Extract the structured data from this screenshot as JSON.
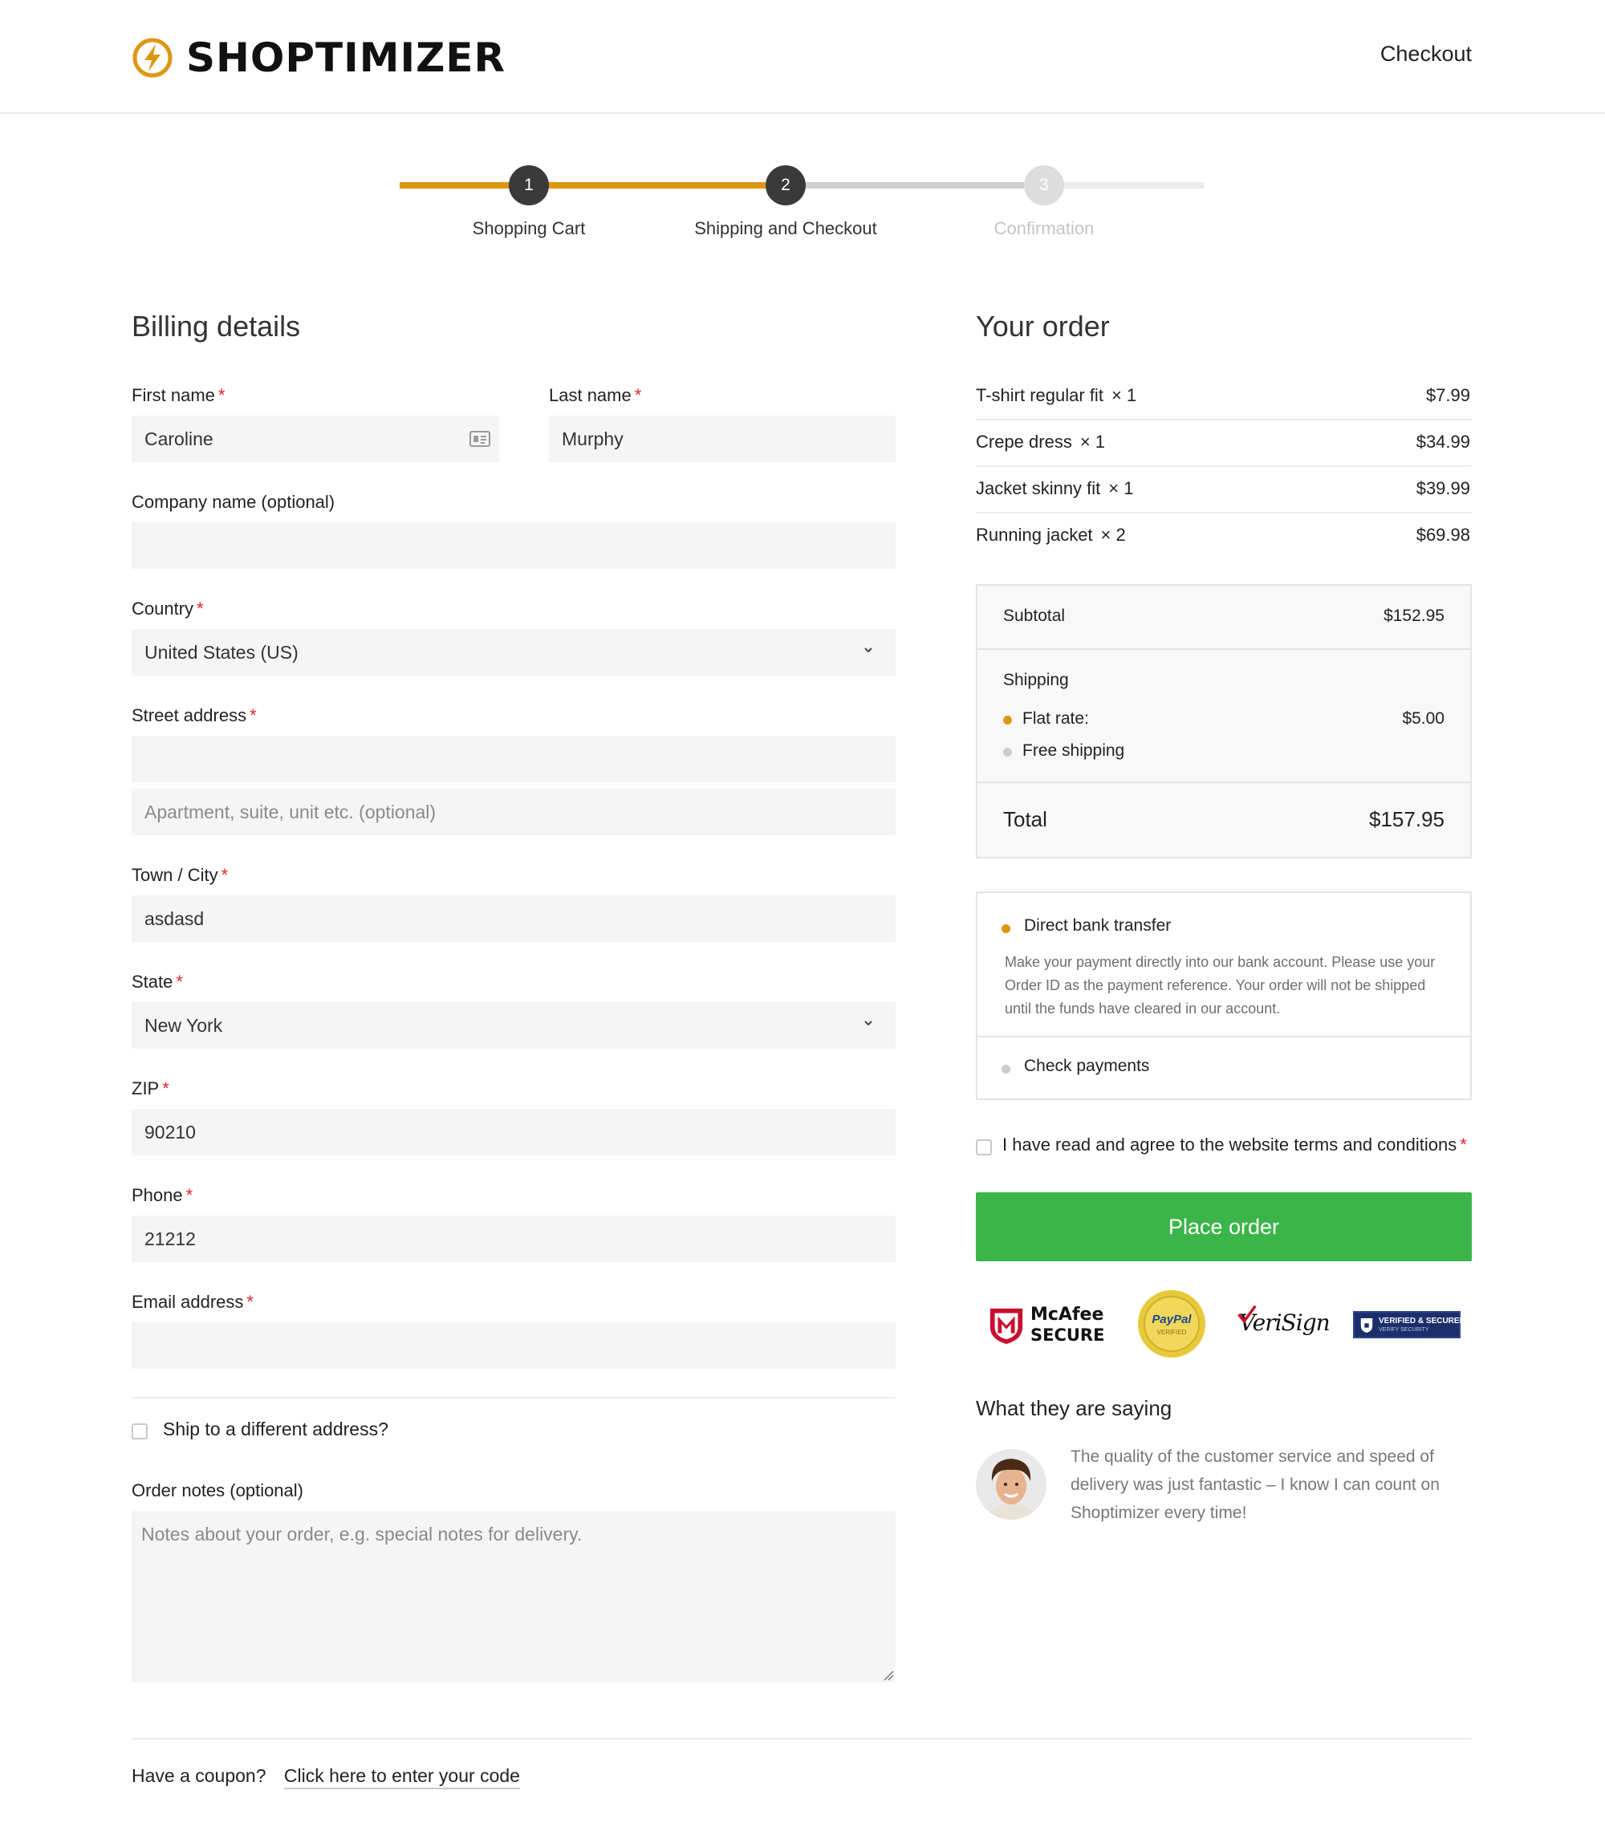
{
  "header": {
    "brand": "SHOPTIMIZER",
    "title": "Checkout"
  },
  "steps": [
    {
      "number": "1",
      "label": "Shopping Cart",
      "state": "done"
    },
    {
      "number": "2",
      "label": "Shipping and Checkout",
      "state": "active"
    },
    {
      "number": "3",
      "label": "Confirmation",
      "state": "upcoming"
    }
  ],
  "billing": {
    "title": "Billing details",
    "required_mark": "*",
    "first_name": {
      "label": "First name",
      "value": "Caroline"
    },
    "last_name": {
      "label": "Last name",
      "value": "Murphy"
    },
    "company": {
      "label": "Company name (optional)",
      "value": ""
    },
    "country": {
      "label": "Country",
      "value": "United States (US)"
    },
    "street": {
      "label": "Street address",
      "value": "",
      "placeholder2": "Apartment, suite, unit etc. (optional)"
    },
    "city": {
      "label": "Town / City",
      "value": "asdasd"
    },
    "state": {
      "label": "State",
      "value": "New York"
    },
    "zip": {
      "label": "ZIP",
      "value": "90210"
    },
    "phone": {
      "label": "Phone",
      "value": "21212"
    },
    "email": {
      "label": "Email address",
      "value": ""
    },
    "ship_different": "Ship to a different address?",
    "notes": {
      "label": "Order notes (optional)",
      "placeholder": "Notes about your order, e.g. special notes for delivery."
    }
  },
  "order": {
    "title": "Your order",
    "items": [
      {
        "name": "T-shirt regular fit",
        "qty": "× 1",
        "price": "$7.99"
      },
      {
        "name": "Crepe dress",
        "qty": "× 1",
        "price": "$34.99"
      },
      {
        "name": "Jacket skinny fit",
        "qty": "× 1",
        "price": "$39.99"
      },
      {
        "name": "Running jacket",
        "qty": "× 2",
        "price": "$69.98"
      }
    ],
    "subtotal_label": "Subtotal",
    "subtotal": "$152.95",
    "shipping_label": "Shipping",
    "shipping_options": [
      {
        "label": "Flat rate:",
        "price": "$5.00",
        "selected": true
      },
      {
        "label": "Free shipping",
        "price": "",
        "selected": false
      }
    ],
    "total_label": "Total",
    "total": "$157.95"
  },
  "payment": {
    "methods": [
      {
        "label": "Direct bank transfer",
        "selected": true,
        "description": "Make your payment directly into our bank account. Please use your Order ID as the payment reference. Your order will not be shipped until the funds have cleared in our account."
      },
      {
        "label": "Check payments",
        "selected": false
      }
    ],
    "terms": "I have read and agree to the website terms and conditions",
    "place_order": "Place order"
  },
  "badges": {
    "mcafee_top": "McAfee",
    "mcafee_bottom": "SECURE",
    "paypal_top": "PayPal",
    "paypal_bottom": "VERIFIED",
    "verisign": "VeriSign",
    "verified_top": "VERIFIED & SECURED",
    "verified_bottom": "VERIFY SECURITY"
  },
  "testimonial": {
    "title": "What they are saying",
    "quote": "The quality of the customer service and speed of delivery was just fantastic – I know I can count on Shoptimizer every time!"
  },
  "coupon": {
    "text": "Have a coupon?",
    "link": "Click here to enter your code"
  },
  "colors": {
    "accent": "#dc9814",
    "step_dark": "#3a3a3a",
    "step_inactive": "#dddddd",
    "button_green": "#3bb54a",
    "required": "#e4232e"
  }
}
